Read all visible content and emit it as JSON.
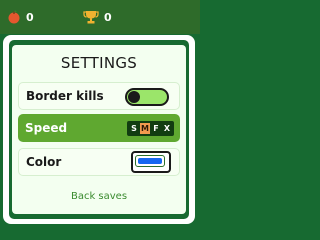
{
  "topbar": {
    "apple_count": "0",
    "trophy_count": "0"
  },
  "panel": {
    "title": "SETTINGS",
    "back_label": "Back saves"
  },
  "settings": {
    "border_kills": {
      "label": "Border kills",
      "enabled": false
    },
    "speed": {
      "label": "Speed",
      "options": [
        "S",
        "M",
        "F",
        "X"
      ],
      "selected": "M"
    },
    "color": {
      "label": "Color",
      "value": "#1666f1"
    }
  },
  "colors": {
    "background": "#176a31",
    "accent_orange": "#f29a4e",
    "selected_row": "#5fa830",
    "snake_color": "#1666f1"
  }
}
